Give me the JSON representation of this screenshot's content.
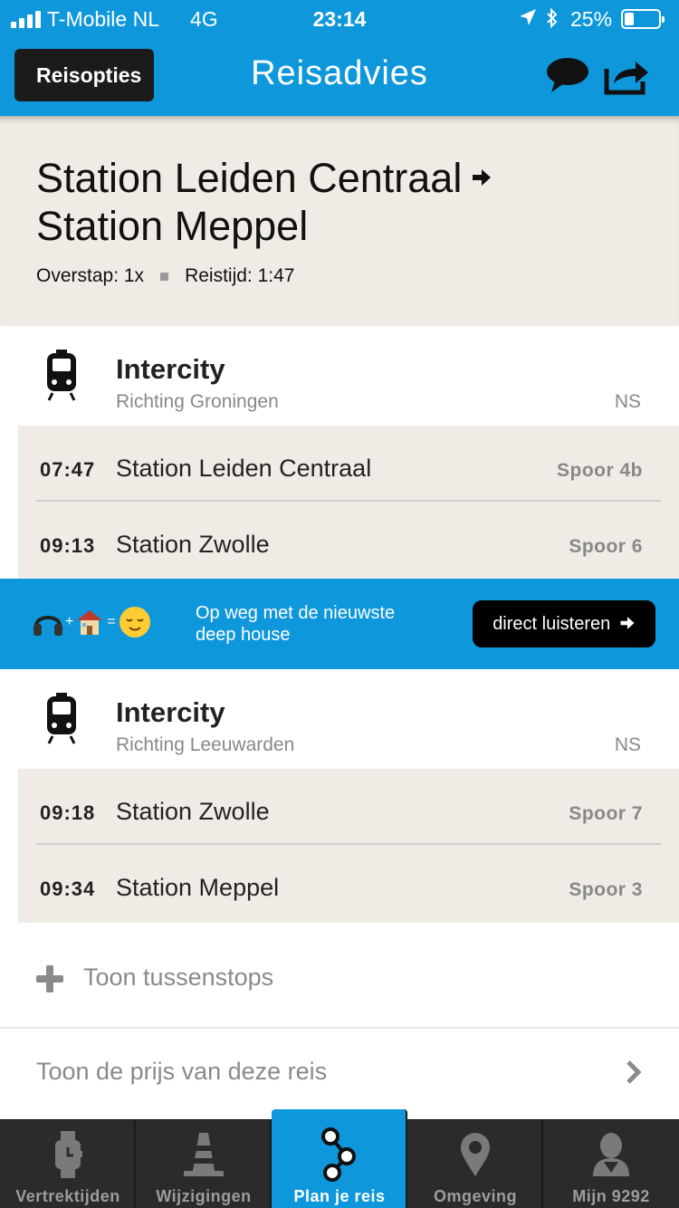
{
  "status_bar": {
    "carrier": "T-Mobile NL",
    "network": "4G",
    "time": "23:14",
    "battery": "25%"
  },
  "nav": {
    "back_label": "Reisopties",
    "title": "Reisadvies"
  },
  "summary": {
    "from": "Station Leiden Centraal",
    "to": "Station Meppel",
    "transfers": "Overstap: 1x",
    "duration": "Reistijd: 1:47"
  },
  "legs": [
    {
      "mode": "Intercity",
      "direction": "Richting Groningen",
      "operator": "NS",
      "stops": [
        {
          "time": "07:47",
          "name": "Station Leiden Centraal",
          "platform": "Spoor 4b"
        },
        {
          "time": "09:13",
          "name": "Station Zwolle",
          "platform": "Spoor 6"
        }
      ]
    },
    {
      "mode": "Intercity",
      "direction": "Richting Leeuwarden",
      "operator": "NS",
      "stops": [
        {
          "time": "09:18",
          "name": "Station Zwolle",
          "platform": "Spoor 7"
        },
        {
          "time": "09:34",
          "name": "Station Meppel",
          "platform": "Spoor 3"
        }
      ]
    }
  ],
  "promo": {
    "text_line1": "Op weg met de nieuwste",
    "text_line2": "deep house",
    "cta": "direct luisteren",
    "emoji_plus": "+",
    "emoji_equals": "="
  },
  "toon_tussenstops": "Toon tussenstops",
  "toon_prijs": "Toon de prijs van deze reis",
  "tabs": [
    {
      "label": "Vertrektijden",
      "icon": "watch-icon"
    },
    {
      "label": "Wijzigingen",
      "icon": "traffic-cone-icon"
    },
    {
      "label": "Plan je reis",
      "icon": "route-icon",
      "active": true
    },
    {
      "label": "Omgeving",
      "icon": "map-pin-icon"
    },
    {
      "label": "Mijn 9292",
      "icon": "person-icon"
    }
  ],
  "colors": {
    "brand_blue": "#0f97db",
    "panel_beige": "#f0ece5",
    "tabbar_dark": "#2b2b2b"
  }
}
